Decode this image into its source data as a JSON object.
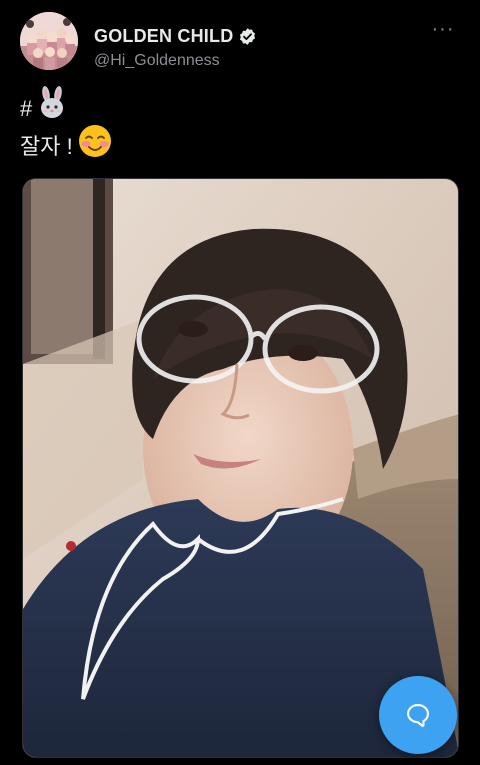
{
  "author": {
    "display_name": "GOLDEN CHILD",
    "handle": "@Hi_Goldenness",
    "verified": true,
    "avatar_icon": "group-photo-avatar"
  },
  "tweet": {
    "hashtag_prefix": "#",
    "hashtag_emoji": "rabbit-emoji",
    "text": "잘자 !",
    "text_emoji": "smiling-face-with-blush-emoji",
    "media": "selfie-photo"
  },
  "menu": {
    "more_label": "···",
    "more_icon": "more-options-icon"
  },
  "fab": {
    "icon": "reply-speech-bubble-icon"
  },
  "colors": {
    "background": "#000000",
    "accent": "#3ea2f3",
    "secondary_text": "#8b8f94",
    "primary_text": "#e7e9ea"
  }
}
